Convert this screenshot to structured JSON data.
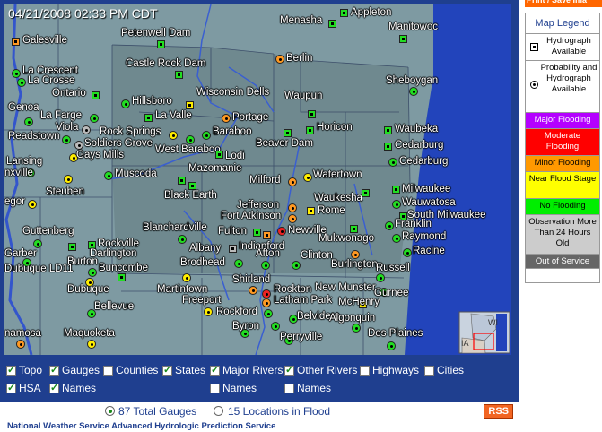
{
  "timestamp": "04/21/2008 02:33 PM CDT",
  "print_button": "Print / Save Ima",
  "legend": {
    "title": "Map Legend",
    "hydrograph": "Hydrograph Available",
    "probability": "Probability and Hydrograph Available",
    "items": [
      {
        "label": "Major Flooding",
        "bg": "#b400ff",
        "fg": "#ffffff"
      },
      {
        "label": "Moderate Flooding",
        "bg": "#ff0000",
        "fg": "#ffffff"
      },
      {
        "label": "Minor Flooding",
        "bg": "#ff9900",
        "fg": "#000000"
      },
      {
        "label": "Near Flood Stage",
        "bg": "#ffff00",
        "fg": "#000000"
      },
      {
        "label": "No Flooding",
        "bg": "#00ee00",
        "fg": "#000000"
      },
      {
        "label": "Observation More Than 24 Hours Old",
        "bg": "#cccccc",
        "fg": "#000000"
      },
      {
        "label": "Out of Service",
        "bg": "#666666",
        "fg": "#ffffff"
      }
    ]
  },
  "places": [
    "Appleton",
    "Menasha",
    "Manitowoc",
    "Galesville",
    "Petenwell Dam",
    "Berlin",
    "Castle Rock Dam",
    "La Crescent",
    "La Crosse",
    "Sheboygan",
    "Ontario",
    "Hillsboro",
    "Wisconsin Dells",
    "Waupun",
    "La Valle",
    "La Farge",
    "Portage",
    "Genoa",
    "Viola",
    "Rock Springs",
    "Baraboo",
    "Horicon",
    "Waubeka",
    "Readstown",
    "Soldiers Grove",
    "West Baraboo",
    "Beaver Dam",
    "Cedarburg",
    "Gays Mills",
    "Lodi",
    "Cedarburg",
    "Lansing",
    "nxville",
    "Muscoda",
    "Mazomanie",
    "Watertown",
    "Milford",
    "Milwaukee",
    "Steuben",
    "Black Earth",
    "Waukesha",
    "Wauwatosa",
    "egor",
    "Jefferson",
    "Rome",
    "South Milwaukee",
    "Fort Atkinson",
    "Franklin",
    "Guttenberg",
    "Blanchardville",
    "Fulton",
    "Newville",
    "Raymond",
    "Mukwonago",
    "Indianford",
    "Albany",
    "Racine",
    "Rockville",
    "Garber",
    "Darlington",
    "Afton",
    "Clinton",
    "Brodhead",
    "Burton",
    "Burlington",
    "Dubuque LD11",
    "Buncombe",
    "Russell",
    "Shirland",
    "Dubuque",
    "Martintown",
    "Rockton",
    "New Munster",
    "Gurnee",
    "Freeport",
    "Latham Park",
    "McHenry",
    "Bellevue",
    "Rockford",
    "Belvidere",
    "Algonquin",
    "Byron",
    "namosa",
    "Maquoketa",
    "Perryville",
    "Des Plaines"
  ],
  "inset": {
    "state_label": "WI",
    "state_label2": "IA"
  },
  "layers": {
    "topo": "Topo",
    "gauges": "Gauges",
    "counties": "Counties",
    "states": "States",
    "major_rivers": "Major Rivers",
    "other_rivers": "Other Rivers",
    "highways": "Highways",
    "cities": "Cities",
    "hsa": "HSA",
    "names": "Names",
    "major_rivers_names": "Names",
    "other_rivers_names": "Names"
  },
  "totals": {
    "total_gauges": "87 Total Gauges",
    "in_flood": "15 Locations in Flood"
  },
  "rss": "RSS",
  "footer": "National Weather Service Advanced Hydrologic Prediction Service"
}
